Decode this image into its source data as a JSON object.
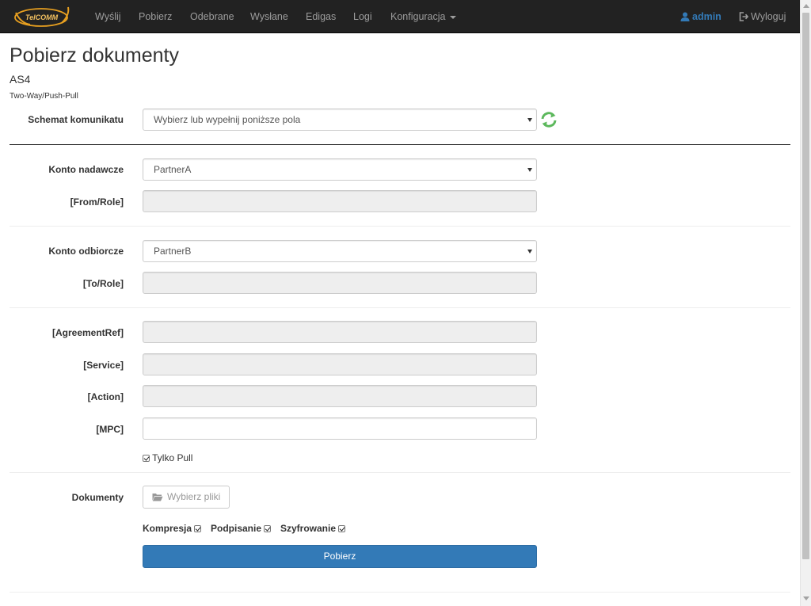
{
  "navbar": {
    "brand_text": "TelCOMM",
    "items": [
      {
        "label": "Wyślij"
      },
      {
        "label": "Pobierz"
      },
      {
        "label": "Odebrane"
      },
      {
        "label": "Wysłane"
      },
      {
        "label": "Edigas"
      },
      {
        "label": "Logi"
      },
      {
        "label": "Konfiguracja"
      }
    ],
    "user": "admin",
    "logout": "Wyloguj"
  },
  "page": {
    "title": "Pobierz dokumenty",
    "subtitle": "AS4",
    "caption": "Two-Way/Push-Pull"
  },
  "form": {
    "schema_label": "Schemat komunikatu",
    "schema_value": "Wybierz lub wypełnij poniższe pola",
    "sender_label": "Konto nadawcze",
    "sender_value": "PartnerA",
    "from_role_label": "[From/Role]",
    "from_role_value": "",
    "receiver_label": "Konto odbiorcze",
    "receiver_value": "PartnerB",
    "to_role_label": "[To/Role]",
    "to_role_value": "",
    "agreement_label": "[AgreementRef]",
    "agreement_value": "",
    "service_label": "[Service]",
    "service_value": "",
    "action_label": "[Action]",
    "action_value": "",
    "mpc_label": "[MPC]",
    "mpc_value": "",
    "only_pull_label": "Tylko Pull",
    "documents_label": "Dokumenty",
    "choose_files_label": "Wybierz pliki",
    "compression_label": "Kompresja",
    "signing_label": "Podpisanie",
    "encryption_label": "Szyfrowanie",
    "submit_label": "Pobierz"
  },
  "colors": {
    "navbar_bg": "#222222",
    "primary": "#337ab7",
    "refresh_icon": "#5cb85c",
    "brand_orange": "#f0a020"
  },
  "icons": {
    "user": "user-icon",
    "logout": "logout-icon",
    "refresh": "refresh-icon",
    "folder": "folder-open-icon"
  }
}
